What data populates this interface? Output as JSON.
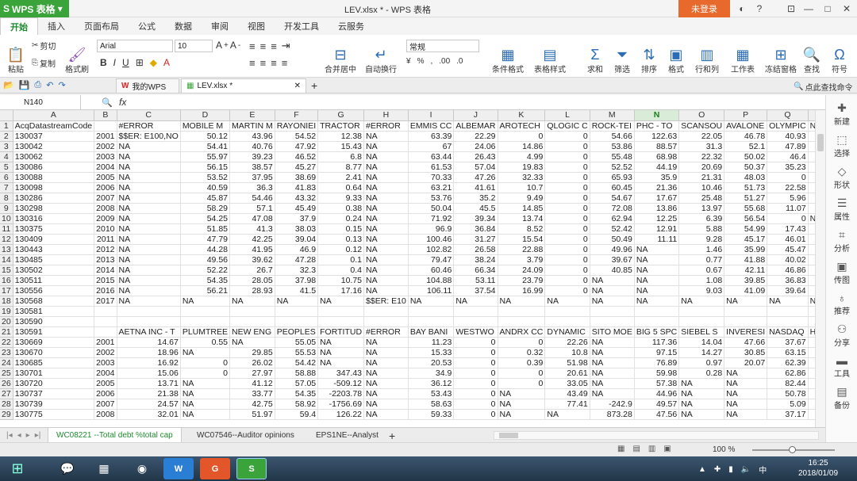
{
  "app": {
    "name": "WPS 表格",
    "title": "LEV.xlsx * - WPS 表格",
    "login": "未登录"
  },
  "menus": [
    "开始",
    "插入",
    "页面布局",
    "公式",
    "数据",
    "审阅",
    "视图",
    "开发工具",
    "云服务"
  ],
  "ribbon": {
    "paste": "粘贴",
    "cut": "剪切",
    "copy": "复制",
    "format_painter": "格式刷",
    "font": "Arial",
    "size": "10",
    "merge": "合并居中",
    "wrap": "自动换行",
    "number_format": "常规",
    "cond_format": "条件格式",
    "table_style": "表格样式",
    "sum": "求和",
    "filter": "筛选",
    "sort": "排序",
    "format": "格式",
    "rowcol": "行和列",
    "sheet": "工作表",
    "freeze": "冻结窗格",
    "find": "查找",
    "symbol": "符号"
  },
  "tabs": {
    "mywps": "我的WPS",
    "file": "LEV.xlsx *",
    "search": "点此查找命令"
  },
  "formula": {
    "cell": "N140",
    "fx": "fx",
    "value": ""
  },
  "columns": [
    "A",
    "B",
    "C",
    "D",
    "E",
    "F",
    "G",
    "H",
    "I",
    "J",
    "K",
    "L",
    "M",
    "N",
    "O",
    "P",
    "Q",
    "R",
    "S"
  ],
  "selected_col": "N",
  "rows": [
    {
      "n": "1",
      "c": [
        "AcqDatastreamCode",
        "",
        "#ERROR",
        "MOBILE M",
        "MARTIN M",
        "RAYONIEI",
        "TRACTOR",
        "#ERROR",
        "EMMIS CC",
        "ALBEMAR",
        "AROTECH",
        "QLOGIC C",
        "ROCK-TEI",
        "PHC - TO",
        "SCANSOU",
        "AVALONE",
        "OLYMPIC",
        "NN INC -",
        "EQUITABI"
      ]
    },
    {
      "n": "2",
      "c": [
        "130037",
        "2001",
        "$$ER: E100,NO",
        "50.12",
        "43.96",
        "54.52",
        "12.38",
        "NA",
        "63.39",
        "22.29",
        "0",
        "0",
        "54.66",
        "122.63",
        "22.05",
        "46.78",
        "40.93",
        "37.51",
        "81.65"
      ]
    },
    {
      "n": "3",
      "c": [
        "130042",
        "2002",
        "NA",
        "54.41",
        "40.76",
        "47.92",
        "15.43",
        "NA",
        "67",
        "24.06",
        "14.86",
        "0",
        "53.86",
        "88.57",
        "31.3",
        "52.1",
        "47.89",
        "36.38",
        "NA"
      ]
    },
    {
      "n": "4",
      "c": [
        "130062",
        "2003",
        "NA",
        "55.97",
        "39.23",
        "46.52",
        "6.8",
        "NA",
        "63.44",
        "26.43",
        "4.99",
        "0",
        "55.48",
        "68.98",
        "22.32",
        "50.02",
        "46.4",
        "44.24",
        "NA"
      ]
    },
    {
      "n": "5",
      "c": [
        "130086",
        "2004",
        "NA",
        "56.15",
        "38.57",
        "45.27",
        "8.77",
        "NA",
        "61.53",
        "57.04",
        "19.83",
        "0",
        "52.52",
        "44.19",
        "20.69",
        "50.37",
        "35.23",
        "39.34",
        "NA"
      ]
    },
    {
      "n": "6",
      "c": [
        "130088",
        "2005",
        "NA",
        "53.52",
        "37.95",
        "38.69",
        "2.41",
        "NA",
        "70.33",
        "47.26",
        "32.33",
        "0",
        "65.93",
        "35.9",
        "21.31",
        "48.03",
        "0",
        "35.71",
        "NA"
      ]
    },
    {
      "n": "7",
      "c": [
        "130098",
        "2006",
        "NA",
        "40.59",
        "36.3",
        "41.83",
        "0.64",
        "NA",
        "63.21",
        "41.61",
        "10.7",
        "0",
        "60.45",
        "21.36",
        "10.46",
        "51.73",
        "22.58",
        "44.04",
        "NA"
      ]
    },
    {
      "n": "8",
      "c": [
        "130286",
        "2007",
        "NA",
        "45.87",
        "54.46",
        "43.32",
        "9.33",
        "NA",
        "53.76",
        "35.2",
        "9.49",
        "0",
        "54.67",
        "17.67",
        "25.48",
        "51.27",
        "5.96",
        "46.73",
        "NA"
      ]
    },
    {
      "n": "9",
      "c": [
        "130298",
        "2008",
        "NA",
        "58.29",
        "57.1",
        "45.49",
        "0.38",
        "NA",
        "50.04",
        "45.5",
        "14.85",
        "0",
        "72.08",
        "13.86",
        "13.97",
        "55.68",
        "11.07",
        "47.48",
        "NA"
      ]
    },
    {
      "n": "10",
      "c": [
        "130316",
        "2009",
        "NA",
        "54.25",
        "47.08",
        "37.9",
        "0.24",
        "NA",
        "71.92",
        "39.34",
        "13.74",
        "0",
        "62.94",
        "12.25",
        "6.39",
        "56.54",
        "0",
        "NA",
        "NA"
      ]
    },
    {
      "n": "11",
      "c": [
        "130375",
        "2010",
        "NA",
        "51.85",
        "41.3",
        "38.03",
        "0.15",
        "NA",
        "96.9",
        "36.84",
        "8.52",
        "0",
        "52.42",
        "12.91",
        "5.88",
        "54.99",
        "17.43",
        "49.14",
        "NA"
      ]
    },
    {
      "n": "12",
      "c": [
        "130409",
        "2011",
        "NA",
        "47.79",
        "42.25",
        "39.04",
        "0.13",
        "NA",
        "100.46",
        "31.27",
        "15.54",
        "0",
        "50.49",
        "11.11",
        "9.28",
        "45.17",
        "46.01",
        "45.2",
        "NA"
      ]
    },
    {
      "n": "13",
      "c": [
        "130443",
        "2012",
        "NA",
        "44.28",
        "41.95",
        "46.9",
        "0.12",
        "NA",
        "102.82",
        "26.58",
        "22.88",
        "0",
        "49.96",
        "NA",
        "1.46",
        "35.99",
        "45.47",
        "36.38",
        "NA"
      ]
    },
    {
      "n": "14",
      "c": [
        "130485",
        "2013",
        "NA",
        "49.56",
        "39.62",
        "47.28",
        "0.1",
        "NA",
        "79.47",
        "38.24",
        "3.79",
        "0",
        "39.67",
        "NA",
        "0.77",
        "41.88",
        "40.02",
        "20.94",
        "NA"
      ]
    },
    {
      "n": "15",
      "c": [
        "130502",
        "2014",
        "NA",
        "52.22",
        "26.7",
        "32.3",
        "0.4",
        "NA",
        "60.46",
        "66.34",
        "24.09",
        "0",
        "40.85",
        "NA",
        "0.67",
        "42.11",
        "46.86",
        "68.06",
        "NA"
      ]
    },
    {
      "n": "16",
      "c": [
        "130511",
        "2015",
        "NA",
        "54.35",
        "28.05",
        "37.98",
        "10.75",
        "NA",
        "104.88",
        "53.11",
        "23.79",
        "0",
        "NA",
        "NA",
        "1.08",
        "39.85",
        "36.83",
        "72.67",
        "NA"
      ]
    },
    {
      "n": "17",
      "c": [
        "130556",
        "2016",
        "NA",
        "56.21",
        "28.93",
        "41.5",
        "17.16",
        "NA",
        "106.11",
        "37.54",
        "16.99",
        "0",
        "NA",
        "NA",
        "9.03",
        "41.09",
        "39.64",
        "71.94",
        "NA"
      ]
    },
    {
      "n": "18",
      "c": [
        "130568",
        "2017",
        "NA",
        "NA",
        "NA",
        "NA",
        "NA",
        "$$ER: E10",
        "NA",
        "NA",
        "NA",
        "NA",
        "NA",
        "NA",
        "NA",
        "NA",
        "NA",
        "NA",
        "NA"
      ]
    },
    {
      "n": "19",
      "c": [
        "130581",
        "",
        "",
        "",
        "",
        "",
        "",
        "",
        "",
        "",
        "",
        "",
        "",
        "",
        "",
        "",
        "",
        "",
        ""
      ]
    },
    {
      "n": "20",
      "c": [
        "130590",
        "",
        "",
        "",
        "",
        "",
        "",
        "",
        "",
        "",
        "",
        "",
        "",
        "",
        "",
        "",
        "",
        "",
        ""
      ]
    },
    {
      "n": "21",
      "c": [
        "130591",
        "",
        "AETNA INC - T",
        "PLUMTREE",
        "NEW ENG",
        "PEOPLES",
        "FORTITUD",
        "#ERROR",
        "BAY BANI",
        "WESTWO",
        "ANDRX CC",
        "DYNAMIC",
        "SITO MOE",
        "BIG 5 SPC",
        "SIEBEL S",
        "INVERESI",
        "NASDAQ",
        "HENNESS",
        "GREEN B"
      ]
    },
    {
      "n": "22",
      "c": [
        "130669",
        "2001",
        "14.67",
        "0.55",
        "NA",
        "55.05",
        "NA",
        "NA",
        "11.23",
        "0",
        "0",
        "22.26",
        "NA",
        "117.36",
        "14.04",
        "47.66",
        "37.67",
        "89.95",
        "53.31"
      ]
    },
    {
      "n": "23",
      "c": [
        "130670",
        "2002",
        "18.96",
        "NA",
        "29.85",
        "55.53",
        "NA",
        "NA",
        "15.33",
        "0",
        "0.32",
        "10.8",
        "NA",
        "97.15",
        "14.27",
        "30.85",
        "63.15",
        "0",
        "55.33"
      ]
    },
    {
      "n": "24",
      "c": [
        "130685",
        "2003",
        "16.92",
        "0",
        "26.02",
        "54.42",
        "NA",
        "NA",
        "20.53",
        "0",
        "0.39",
        "51.98",
        "NA",
        "76.89",
        "0.97",
        "20.07",
        "62.39",
        "6.31",
        "45.83"
      ]
    },
    {
      "n": "25",
      "c": [
        "130701",
        "2004",
        "15.06",
        "0",
        "27.97",
        "58.88",
        "347.43",
        "NA",
        "34.9",
        "0",
        "0",
        "20.61",
        "NA",
        "59.98",
        "0.28",
        "NA",
        "62.86",
        "40.66",
        "50.16"
      ]
    },
    {
      "n": "26",
      "c": [
        "130720",
        "2005",
        "13.71",
        "NA",
        "41.12",
        "57.05",
        "-509.12",
        "NA",
        "36.12",
        "0",
        "0",
        "33.05",
        "NA",
        "57.38",
        "NA",
        "NA",
        "82.44",
        "48.3",
        "44.74"
      ]
    },
    {
      "n": "27",
      "c": [
        "130737",
        "2006",
        "21.38",
        "NA",
        "33.77",
        "54.35",
        "-2203.78",
        "NA",
        "53.43",
        "0",
        "NA",
        "43.49",
        "NA",
        "44.96",
        "NA",
        "NA",
        "50.78",
        "36.07",
        "55.83"
      ]
    },
    {
      "n": "28",
      "c": [
        "130739",
        "2007",
        "24.57",
        "NA",
        "42.75",
        "58.92",
        "-1756.69",
        "NA",
        "58.63",
        "0",
        "NA",
        "77.41",
        "-242.9",
        "49.57",
        "NA",
        "NA",
        "5.09",
        "26.91",
        "65.11"
      ]
    },
    {
      "n": "29",
      "c": [
        "130775",
        "2008",
        "32.01",
        "NA",
        "51.97",
        "59.4",
        "126.22",
        "NA",
        "59.33",
        "0",
        "NA",
        "NA",
        "873.28",
        "47.56",
        "NA",
        "NA",
        "37.17",
        "20.97",
        "48.1"
      ]
    }
  ],
  "sheets": [
    "WC08221 --Total debt %total cap",
    "WC07546--Auditor opinions",
    "EPS1NE--Analyst"
  ],
  "side": [
    "新建",
    "选择",
    "形状",
    "属性",
    "分析",
    "传图",
    "推荐",
    "分享",
    "工具",
    "备份"
  ],
  "status": {
    "zoom": "100 %"
  },
  "clock": {
    "time": "16:25",
    "date": "2018/01/09"
  }
}
